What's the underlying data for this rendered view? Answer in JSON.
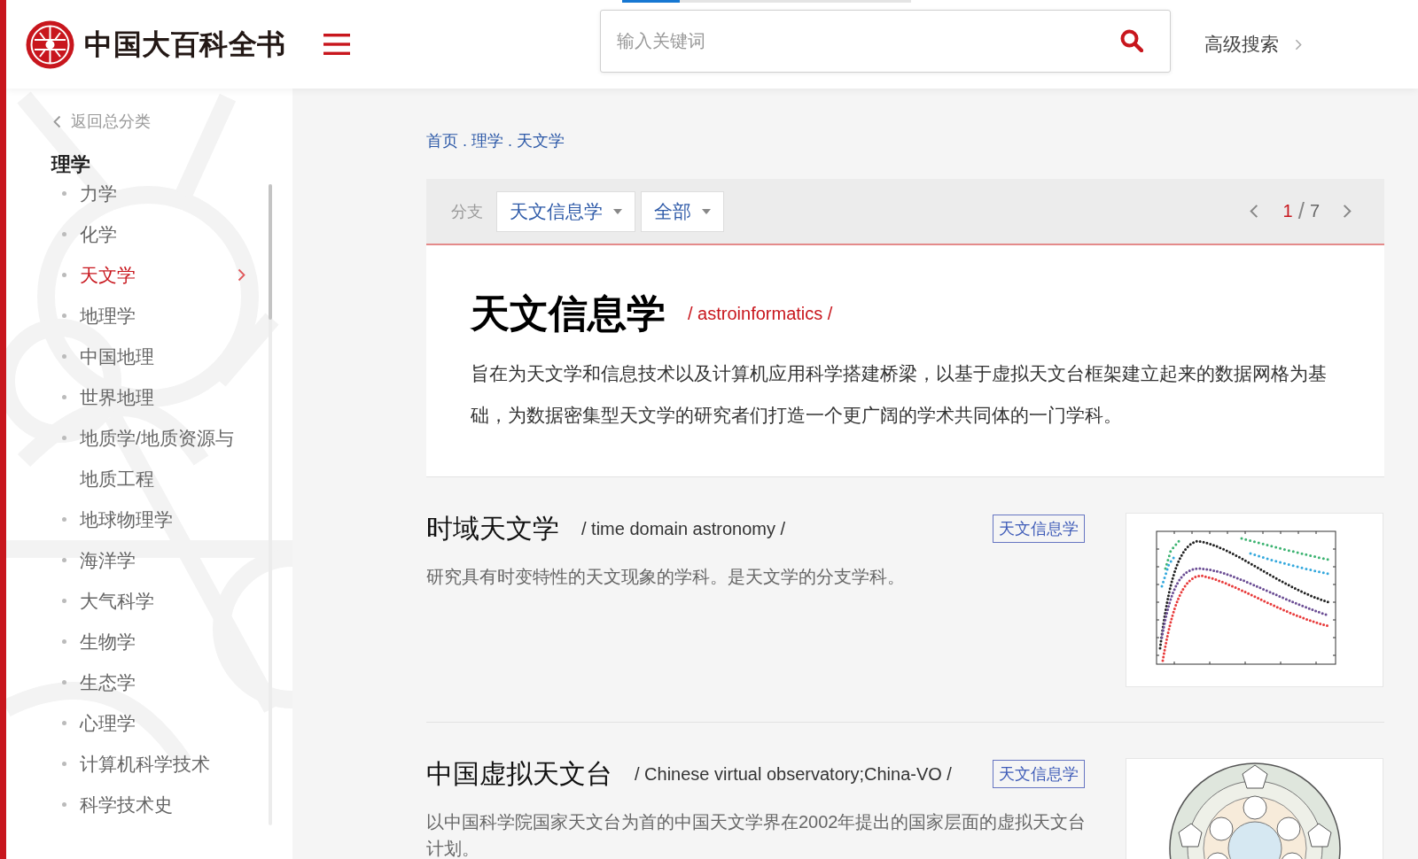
{
  "header": {
    "logo_text": "中国大百科全书",
    "progress": {
      "level": 0.2
    },
    "search": {
      "placeholder": "输入关键词"
    },
    "advanced_search": "高级搜索"
  },
  "sidebar": {
    "back_link": "返回总分类",
    "category": "理学",
    "items": [
      {
        "label": "力学",
        "selected": false
      },
      {
        "label": "化学",
        "selected": false
      },
      {
        "label": "天文学",
        "selected": true
      },
      {
        "label": "地理学",
        "selected": false
      },
      {
        "label": "中国地理",
        "selected": false
      },
      {
        "label": "世界地理",
        "selected": false
      },
      {
        "label": "地质学/地质资源与地质工程",
        "selected": false
      },
      {
        "label": "地球物理学",
        "selected": false
      },
      {
        "label": "海洋学",
        "selected": false
      },
      {
        "label": "大气科学",
        "selected": false
      },
      {
        "label": "生物学",
        "selected": false
      },
      {
        "label": "生态学",
        "selected": false
      },
      {
        "label": "心理学",
        "selected": false
      },
      {
        "label": "计算机科学技术",
        "selected": false
      },
      {
        "label": "科学技术史",
        "selected": false
      }
    ]
  },
  "breadcrumb": {
    "items": [
      "首页",
      "理学",
      "天文学"
    ],
    "separator": "."
  },
  "filter_bar": {
    "label": "分支",
    "dropdowns": [
      "天文信息学",
      "全部"
    ],
    "pager": {
      "current": "1",
      "separator": "/",
      "total": "7"
    }
  },
  "feature": {
    "title": "天文信息学",
    "english": "/ astroinformatics /",
    "description": "旨在为天文学和信息技术以及计算机应用科学搭建桥梁，以基于虚拟天文台框架建立起来的数据网格为基础，为数据密集型天文学的研究者们打造一个更广阔的学术共同体的一门学科。"
  },
  "entries": [
    {
      "kind": "plot",
      "title": "时域天文学",
      "english": "/ time domain astronomy /",
      "tag": "天文信息学",
      "description": "研究具有时变特性的天文现象的学科。是天文学的分支学科。"
    },
    {
      "kind": "diagram",
      "title": "中国虚拟天文台",
      "english": "/ Chinese virtual observatory;China-VO /",
      "tag": "天文信息学",
      "description": "以中国科学院国家天文台为首的中国天文学界在2002年提出的国家层面的虚拟天文台计划。"
    }
  ]
}
